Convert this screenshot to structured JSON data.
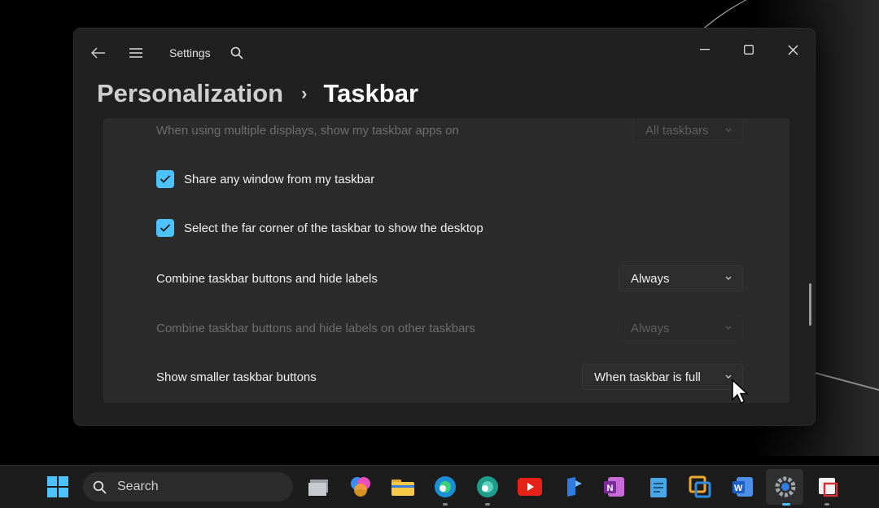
{
  "window": {
    "app_title": "Settings",
    "breadcrumb": {
      "parent": "Personalization",
      "separator": "›",
      "current": "Taskbar"
    }
  },
  "settings": {
    "partial_row": {
      "label": "When using multiple displays, show my taskbar apps on",
      "value": "All taskbars"
    },
    "share_window": {
      "label": "Share any window from my taskbar",
      "checked": true
    },
    "far_corner": {
      "label": "Select the far corner of the taskbar to show the desktop",
      "checked": true
    },
    "combine": {
      "label": "Combine taskbar buttons and hide labels",
      "value": "Always"
    },
    "combine_other": {
      "label": "Combine taskbar buttons and hide labels on other taskbars",
      "value": "Always"
    },
    "smaller": {
      "label": "Show smaller taskbar buttons",
      "value": "When taskbar is full"
    }
  },
  "taskbar": {
    "search_placeholder": "Search",
    "icons": [
      "start-icon",
      "search-icon",
      "file-explorer-old-icon",
      "copilot-icon",
      "file-explorer-icon",
      "edge-icon",
      "edge-beta-icon",
      "youtube-icon",
      "pen-icon",
      "onenote-icon",
      "notepad-icon",
      "folder-sync-icon",
      "word-icon",
      "settings-icon",
      "snipping-icon"
    ]
  },
  "colors": {
    "accent": "#4cc2ff",
    "window_bg": "#202020",
    "card_bg": "#2b2b2b"
  }
}
